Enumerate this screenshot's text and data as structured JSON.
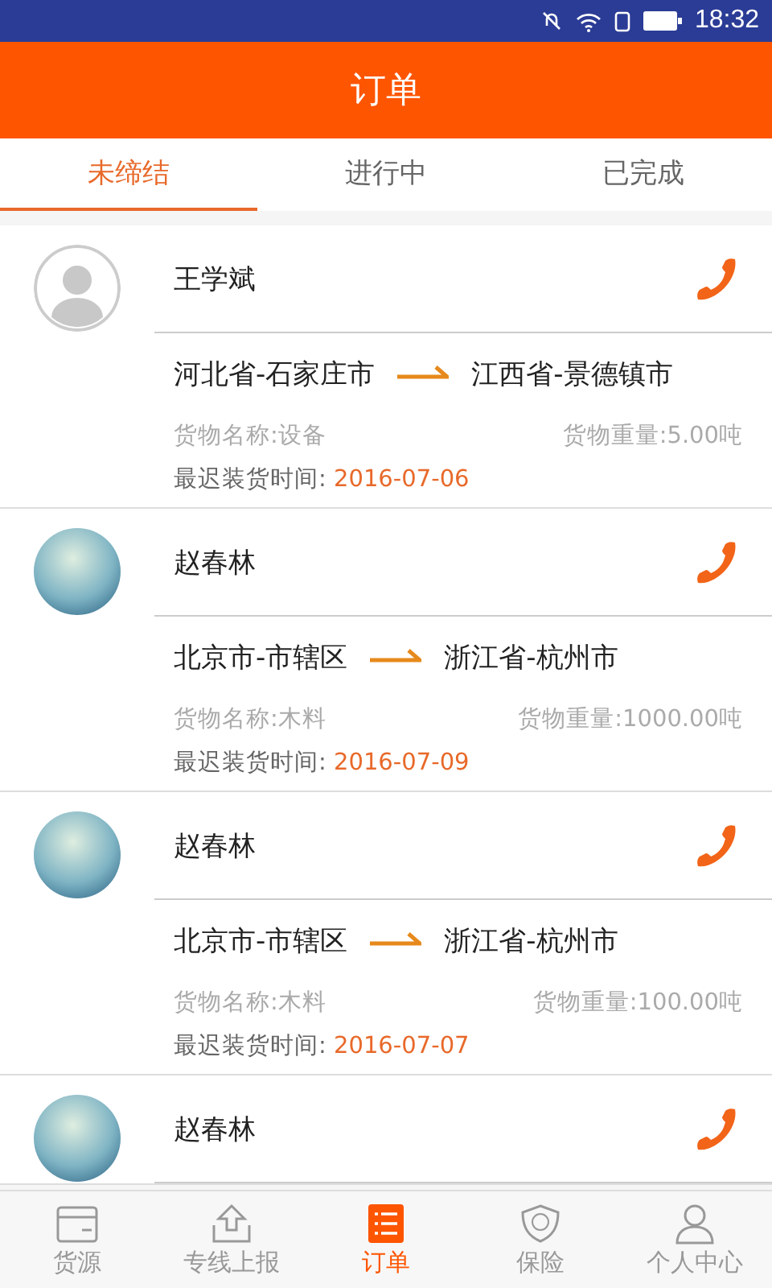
{
  "status_bar": {
    "time": "18:32"
  },
  "header": {
    "title": "订单"
  },
  "tabs": [
    {
      "label": "未缔结",
      "selected": true
    },
    {
      "label": "进行中",
      "selected": false
    },
    {
      "label": "已完成",
      "selected": false
    }
  ],
  "orders": [
    {
      "kind": "silhouette",
      "name": "王学斌",
      "from": "河北省-石家庄市",
      "to": "江西省-景德镇市",
      "cargo_name": "货物名称:设备",
      "cargo_weight": "货物重量:5.00吨",
      "deadline_label": "最迟装货时间:",
      "deadline": "2016-07-06"
    },
    {
      "kind": "photo",
      "name": "赵春林",
      "from": "北京市-市辖区",
      "to": "浙江省-杭州市",
      "cargo_name": "货物名称:木料",
      "cargo_weight": "货物重量:1000.00吨",
      "deadline_label": "最迟装货时间:",
      "deadline": "2016-07-09"
    },
    {
      "kind": "photo",
      "name": "赵春林",
      "from": "北京市-市辖区",
      "to": "浙江省-杭州市",
      "cargo_name": "货物名称:木料",
      "cargo_weight": "货物重量:100.00吨",
      "deadline_label": "最迟装货时间:",
      "deadline": "2016-07-07"
    },
    {
      "kind": "photo",
      "name": "赵春林"
    }
  ],
  "bottom_nav": [
    {
      "kind": "box",
      "label": "货源",
      "selected": false
    },
    {
      "kind": "upload",
      "label": "专线上报",
      "selected": false
    },
    {
      "kind": "list",
      "label": "订单",
      "selected": true
    },
    {
      "kind": "shield",
      "label": "保险",
      "selected": false
    },
    {
      "kind": "person",
      "label": "个人中心",
      "selected": false
    }
  ]
}
